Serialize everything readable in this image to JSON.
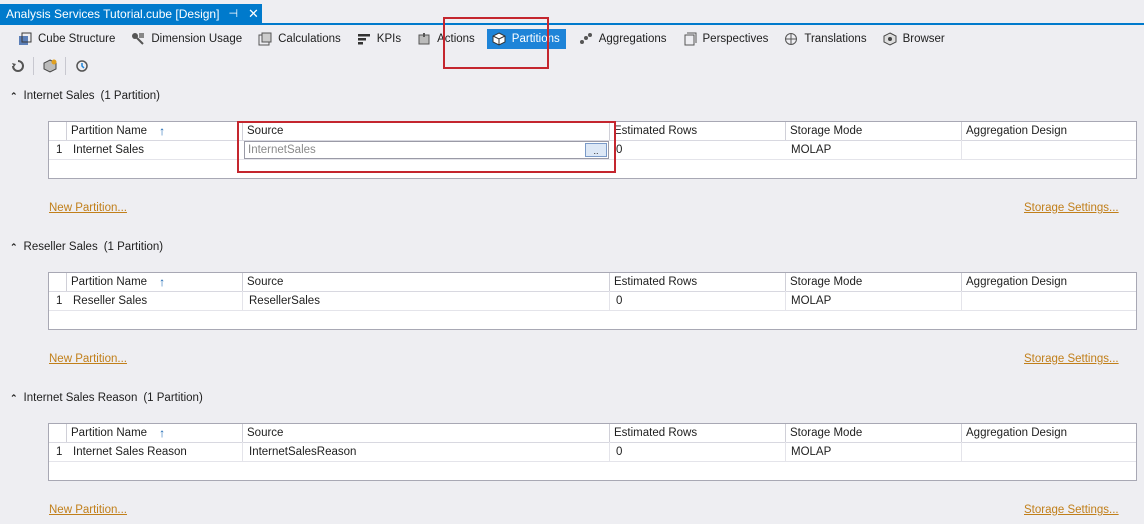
{
  "document_tab": {
    "title": "Analysis Services Tutorial.cube [Design]",
    "pin_glyph": "⊣",
    "close_glyph": "✕"
  },
  "toolbar": {
    "items": [
      {
        "label": "Cube Structure",
        "icon": "cube-structure-icon"
      },
      {
        "label": "Dimension Usage",
        "icon": "dimension-usage-icon"
      },
      {
        "label": "Calculations",
        "icon": "calculations-icon"
      },
      {
        "label": "KPIs",
        "icon": "kpis-icon"
      },
      {
        "label": "Actions",
        "icon": "actions-icon"
      },
      {
        "label": "Partitions",
        "icon": "partitions-icon",
        "active": true
      },
      {
        "label": "Aggregations",
        "icon": "aggregations-icon"
      },
      {
        "label": "Perspectives",
        "icon": "perspectives-icon"
      },
      {
        "label": "Translations",
        "icon": "translations-icon"
      },
      {
        "label": "Browser",
        "icon": "browser-icon"
      }
    ]
  },
  "secondary_toolbar": {
    "buttons": [
      "process-icon",
      "new-partition-icon",
      "refresh-icon"
    ]
  },
  "columns": [
    "Partition Name",
    "Source",
    "Estimated Rows",
    "Storage Mode",
    "Aggregation Design"
  ],
  "sections": [
    {
      "title": "Internet Sales",
      "count": "(1 Partition)",
      "row": {
        "index": "1",
        "name": "Internet Sales",
        "source": "InternetSales",
        "rows": "0",
        "storage": "MOLAP",
        "aggregation": "",
        "editing_source": true,
        "button_label": ".."
      },
      "new_partition": "New Partition...",
      "storage_settings": "Storage Settings..."
    },
    {
      "title": "Reseller Sales",
      "count": "(1 Partition)",
      "row": {
        "index": "1",
        "name": "Reseller Sales",
        "source": "ResellerSales",
        "rows": "0",
        "storage": "MOLAP",
        "aggregation": ""
      },
      "new_partition": "New Partition...",
      "storage_settings": "Storage Settings..."
    },
    {
      "title": "Internet Sales Reason",
      "count": "(1 Partition)",
      "row": {
        "index": "1",
        "name": "Internet Sales Reason",
        "source": "InternetSalesReason",
        "rows": "0",
        "storage": "MOLAP",
        "aggregation": ""
      },
      "new_partition": "New Partition...",
      "storage_settings": "Storage Settings..."
    }
  ],
  "colors": {
    "accent": "#007acc",
    "active_tab": "#1e84d8",
    "highlight_box": "#c4262e",
    "link": "#c17f1a"
  }
}
